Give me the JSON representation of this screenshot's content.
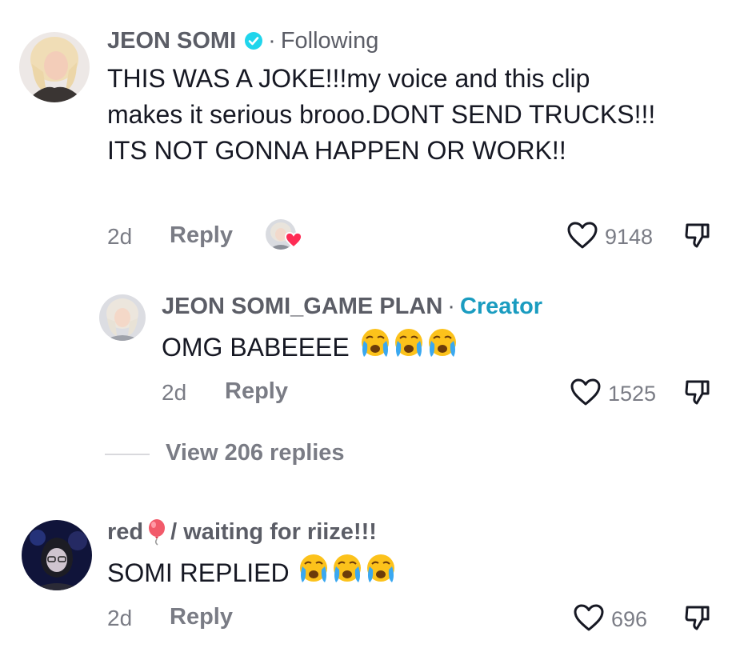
{
  "comments": [
    {
      "username": "JEON SOMI",
      "verified_icon": "verified-badge-icon",
      "relation": "Following",
      "text": "THIS WAS A JOKE!!!my voice and this clip makes it serious brooo.DONT SEND TRUCKS!!! ITS NOT GONNA HAPPEN OR WORK!!",
      "time": "2d",
      "reply_label": "Reply",
      "like_count": "9148",
      "creator_liked": true,
      "replies": [
        {
          "username": "JEON SOMI_GAME PLAN",
          "badge": "Creator",
          "text": "OMG BABEEEE",
          "emoji": "crying-face",
          "emoji_count": 3,
          "time": "2d",
          "reply_label": "Reply",
          "like_count": "1525"
        }
      ],
      "view_replies_label": "View 206 replies"
    },
    {
      "username": "red",
      "username_emoji": "balloon",
      "username_suffix": "/ waiting for riize!!!",
      "text": "SOMI REPLIED",
      "emoji": "crying-face",
      "emoji_count": 3,
      "time": "2d",
      "reply_label": "Reply",
      "like_count": "696"
    }
  ],
  "colors": {
    "text": "#161823",
    "muted": "#7a7c85",
    "creator_badge": "#1a9cc0",
    "verified": "#20d5ec",
    "liked_heart": "#fe2c55"
  }
}
